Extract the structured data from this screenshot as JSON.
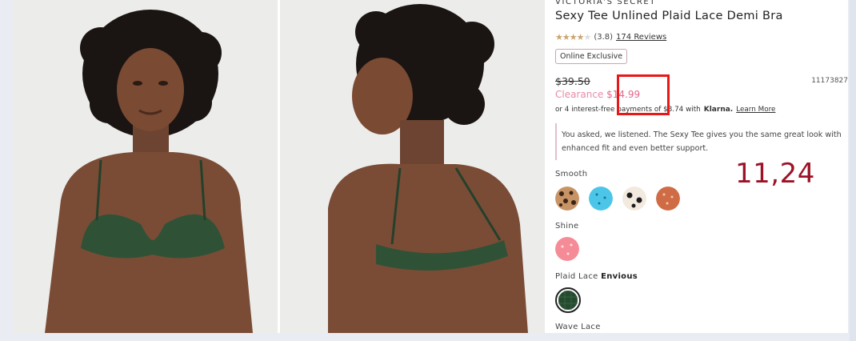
{
  "product": {
    "brand": "VICTORIA'S SECRET",
    "title": "Sexy Tee Unlined Plaid Lace Demi Bra",
    "rating": "(3.8)",
    "reviews": "174 Reviews",
    "badge": "Online Exclusive",
    "original_price": "$39.50",
    "sku": "11173827",
    "clearance_label": "Clearance",
    "clearance_price": "$14.99",
    "installments_text": "or 4 interest-free payments of $3.74 with",
    "klarna": "Klarna.",
    "learn_more": "Learn More",
    "notice": "You asked, we listened. The Sexy Tee gives you the same great look with enhanced fit and even better support."
  },
  "swatches": {
    "smooth_label": "Smooth",
    "shine_label": "Shine",
    "plaid_label": "Plaid Lace",
    "plaid_selected": "Envious",
    "wave_label": "Wave Lace"
  },
  "annotation": {
    "text": "11,24",
    "color": "#9c1226",
    "box_color": "#e81818"
  },
  "images": {
    "front_icon": "model-front-photo",
    "back_icon": "model-back-photo"
  }
}
